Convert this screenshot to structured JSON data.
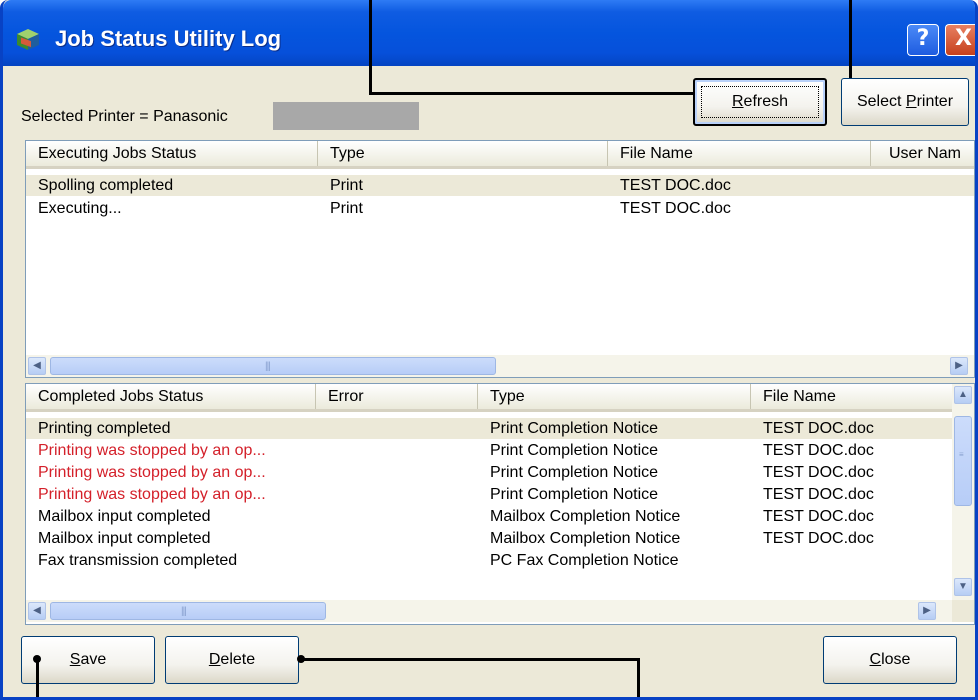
{
  "window": {
    "title": "Job Status Utility Log",
    "title_bar_buttons": [
      "?",
      "X"
    ]
  },
  "toolbar": {
    "printer_label": "Selected Printer = Panasonic",
    "refresh_label": "Refresh",
    "refresh_mnemonic": "R",
    "refresh_rest": "efresh",
    "select_printer_prefix": "Select ",
    "select_printer_mnemonic": "P",
    "select_printer_rest": "rinter"
  },
  "executing": {
    "columns": [
      "Executing Jobs Status",
      "Type",
      "File Name",
      "User Nam"
    ],
    "rows": [
      {
        "status": "Spolling completed",
        "type": "Print",
        "file": "TEST DOC.doc",
        "user": ""
      },
      {
        "status": "Executing...",
        "type": "Print",
        "file": "TEST DOC.doc",
        "user": ""
      }
    ]
  },
  "completed": {
    "columns": [
      "Completed Jobs Status",
      "Error",
      "Type",
      "File Name"
    ],
    "rows": [
      {
        "status": "Printing completed",
        "error": "",
        "type": "Print Completion Notice",
        "file": "TEST DOC.doc",
        "red": false
      },
      {
        "status": "Printing was stopped by an op...",
        "error": "",
        "type": "Print Completion Notice",
        "file": "TEST DOC.doc",
        "red": true
      },
      {
        "status": "Printing was stopped by an op...",
        "error": "",
        "type": "Print Completion Notice",
        "file": "TEST DOC.doc",
        "red": true
      },
      {
        "status": "Printing was stopped by an op...",
        "error": "",
        "type": "Print Completion Notice",
        "file": "TEST DOC.doc",
        "red": true
      },
      {
        "status": "Mailbox input completed",
        "error": "",
        "type": "Mailbox Completion Notice",
        "file": "TEST DOC.doc",
        "red": false
      },
      {
        "status": "Mailbox input completed",
        "error": "",
        "type": "Mailbox Completion Notice",
        "file": "TEST DOC.doc",
        "red": false
      },
      {
        "status": "Fax transmission completed",
        "error": "",
        "type": "PC Fax Completion Notice",
        "file": "",
        "red": false
      }
    ]
  },
  "footer": {
    "save_mnemonic": "S",
    "save_rest": "ave",
    "delete_mnemonic": "D",
    "delete_rest": "elete",
    "close_mnemonic": "C",
    "close_rest": "lose"
  },
  "colors": {
    "title_bar": "#0555DE",
    "window_bg": "#ECE9D8",
    "error_text": "#D4202A",
    "selected_row": "#ECE9D8"
  },
  "icons": [
    "app-icon",
    "help-icon",
    "close-icon",
    "chevron-left-icon",
    "chevron-right-icon",
    "chevron-up-icon",
    "chevron-down-icon"
  ]
}
